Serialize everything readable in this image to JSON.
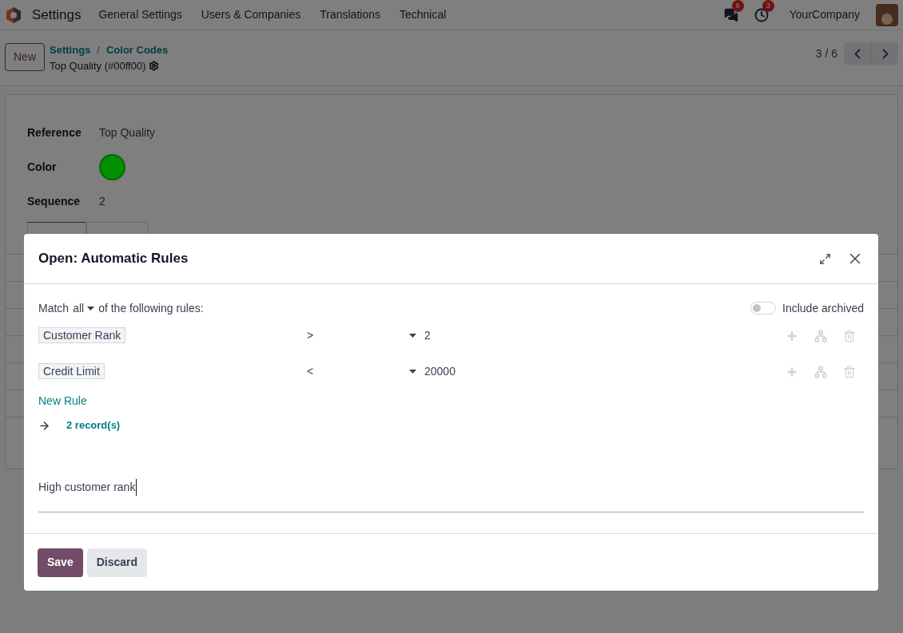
{
  "navbar": {
    "app": "Settings",
    "menu": [
      "General Settings",
      "Users & Companies",
      "Translations",
      "Technical"
    ],
    "messages_badge": "6",
    "activities_badge": "3",
    "company": "YourCompany"
  },
  "control_panel": {
    "new_button": "New",
    "breadcrumbs": [
      "Settings",
      "Color Codes"
    ],
    "breadcrumb_separator": "/",
    "record_title": "Top Quality (#00ff00)",
    "pager": "3 / 6"
  },
  "form": {
    "fields": [
      {
        "kind": "text",
        "label": "Reference",
        "value": "Top Quality"
      },
      {
        "kind": "color",
        "label": "Color",
        "color": "#009000"
      },
      {
        "kind": "text",
        "label": "Sequence",
        "value": "2"
      }
    ],
    "tabs": [
      {
        "selected": true
      },
      {
        "selected": false
      }
    ]
  },
  "dialog": {
    "title": "Open: Automatic Rules",
    "match_prefix": "Match",
    "match_value": "all",
    "match_suffix": "of the following rules:",
    "include_archived": {
      "label": "Include archived",
      "on": false
    },
    "rules": [
      {
        "field": "Customer Rank",
        "operator": ">",
        "value": "2"
      },
      {
        "field": "Credit Limit",
        "operator": "<",
        "value": "20000"
      }
    ],
    "new_rule": "New Rule",
    "records": "2 record(s)",
    "description": "High customer rank",
    "buttons": [
      {
        "label": "Save",
        "kind": "primary"
      },
      {
        "label": "Discard",
        "kind": "secondary"
      }
    ]
  }
}
